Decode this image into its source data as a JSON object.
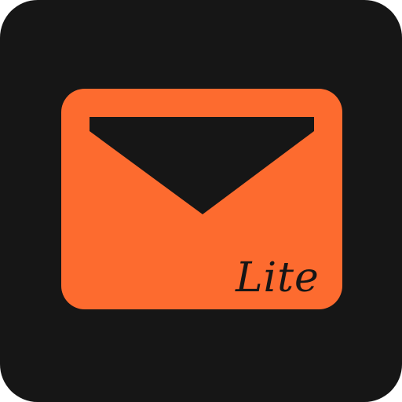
{
  "icon": {
    "name": "mail-envelope",
    "badge": "Lite",
    "colors": {
      "background": "#161616",
      "envelope": "#fd6b2f",
      "flap": "#161616",
      "badge_text": "#161616"
    }
  }
}
